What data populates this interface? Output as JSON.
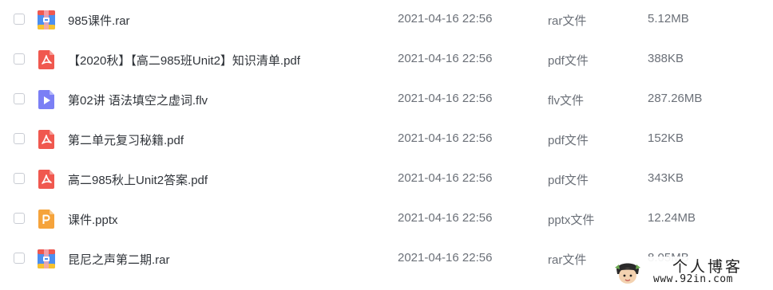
{
  "files": [
    {
      "name": "985课件.rar",
      "date": "2021-04-16 22:56",
      "type": "rar文件",
      "size": "5.12MB",
      "icon": "archive-icon"
    },
    {
      "name": "【2020秋】【高二985班Unit2】知识清单.pdf",
      "date": "2021-04-16 22:56",
      "type": "pdf文件",
      "size": "388KB",
      "icon": "pdf-icon"
    },
    {
      "name": "第02讲 语法填空之虚词.flv",
      "date": "2021-04-16 22:56",
      "type": "flv文件",
      "size": "287.26MB",
      "icon": "video-icon"
    },
    {
      "name": "第二单元复习秘籍.pdf",
      "date": "2021-04-16 22:56",
      "type": "pdf文件",
      "size": "152KB",
      "icon": "pdf-icon"
    },
    {
      "name": "高二985秋上Unit2答案.pdf",
      "date": "2021-04-16 22:56",
      "type": "pdf文件",
      "size": "343KB",
      "icon": "pdf-icon"
    },
    {
      "name": "课件.pptx",
      "date": "2021-04-16 22:56",
      "type": "pptx文件",
      "size": "12.24MB",
      "icon": "powerpoint-icon"
    },
    {
      "name": "昆尼之声第二期.rar",
      "date": "2021-04-16 22:56",
      "type": "rar文件",
      "size": "8.05MB",
      "icon": "archive-icon"
    }
  ],
  "watermark": {
    "title": "个人博客",
    "url": "www.92in.com"
  },
  "colors": {
    "pdf": "#f0584f",
    "video": "#7b7ff5",
    "ppt": "#f5a33b",
    "archive_blue": "#4c8ff0",
    "archive_red": "#f0584f",
    "archive_yellow": "#f7c22f"
  }
}
